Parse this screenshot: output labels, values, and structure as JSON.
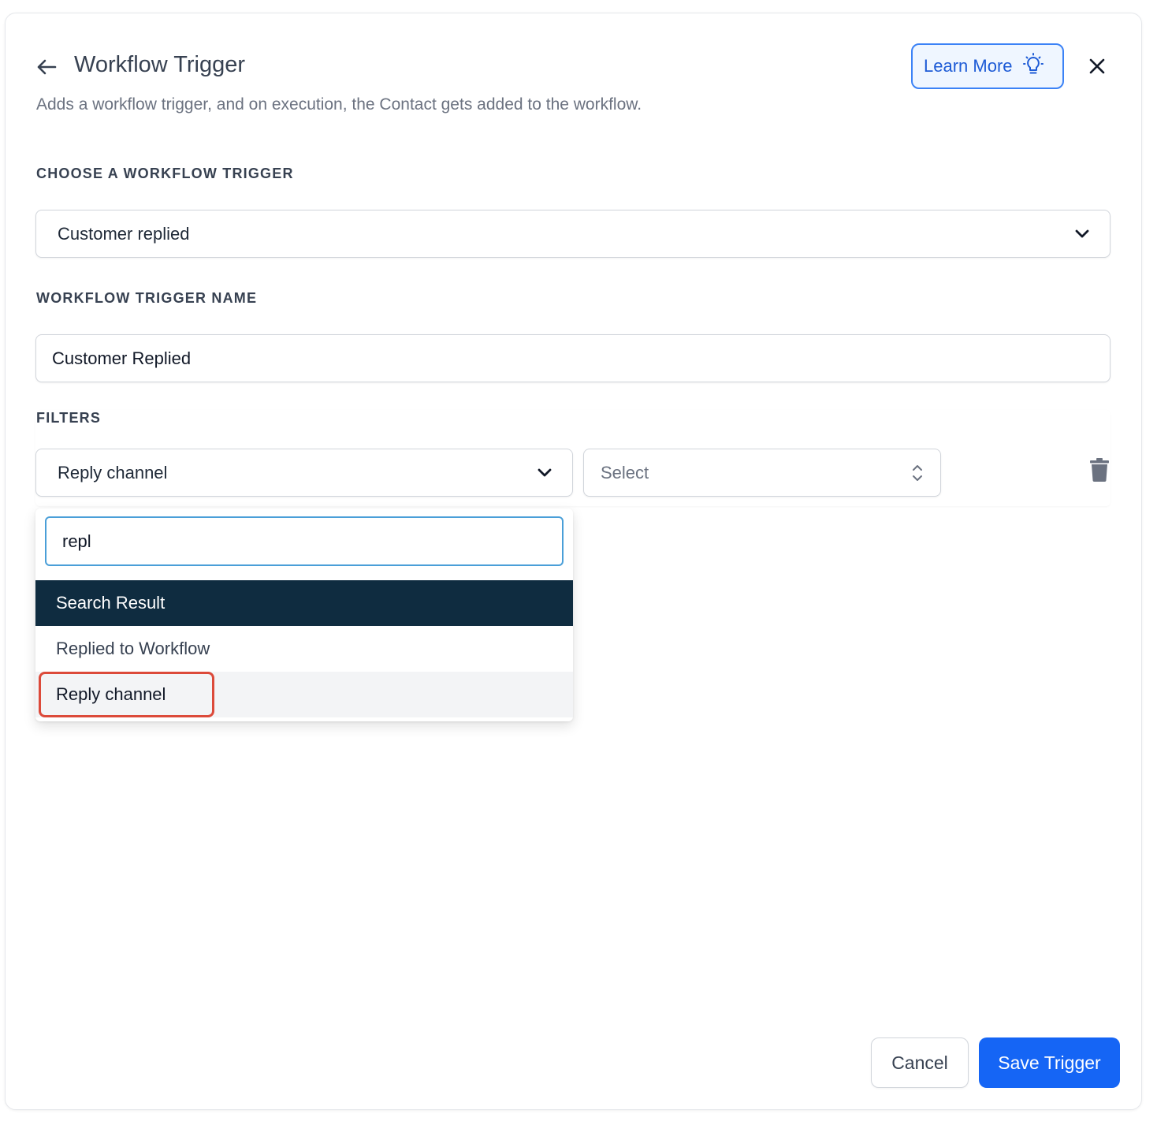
{
  "header": {
    "title": "Workflow Trigger",
    "subtitle": "Adds a workflow trigger, and on execution, the Contact gets added to the workflow.",
    "learn_more_label": "Learn More"
  },
  "trigger_select": {
    "label": "CHOOSE A WORKFLOW TRIGGER",
    "value": "Customer replied"
  },
  "trigger_name": {
    "label": "WORKFLOW TRIGGER NAME",
    "value": "Customer Replied"
  },
  "filters": {
    "label": "FILTERS",
    "field_value": "Reply channel",
    "operator_placeholder": "Select",
    "dropdown": {
      "search_value": "repl",
      "header": "Search Result",
      "options": [
        "Replied to Workflow",
        "Reply channel"
      ]
    }
  },
  "footer": {
    "cancel_label": "Cancel",
    "save_label": "Save Trigger"
  },
  "colors": {
    "primary": "#1565f5",
    "dropdown_header": "#0f2c40",
    "highlight": "#dc4a3a",
    "focus": "#4a9fd8"
  }
}
